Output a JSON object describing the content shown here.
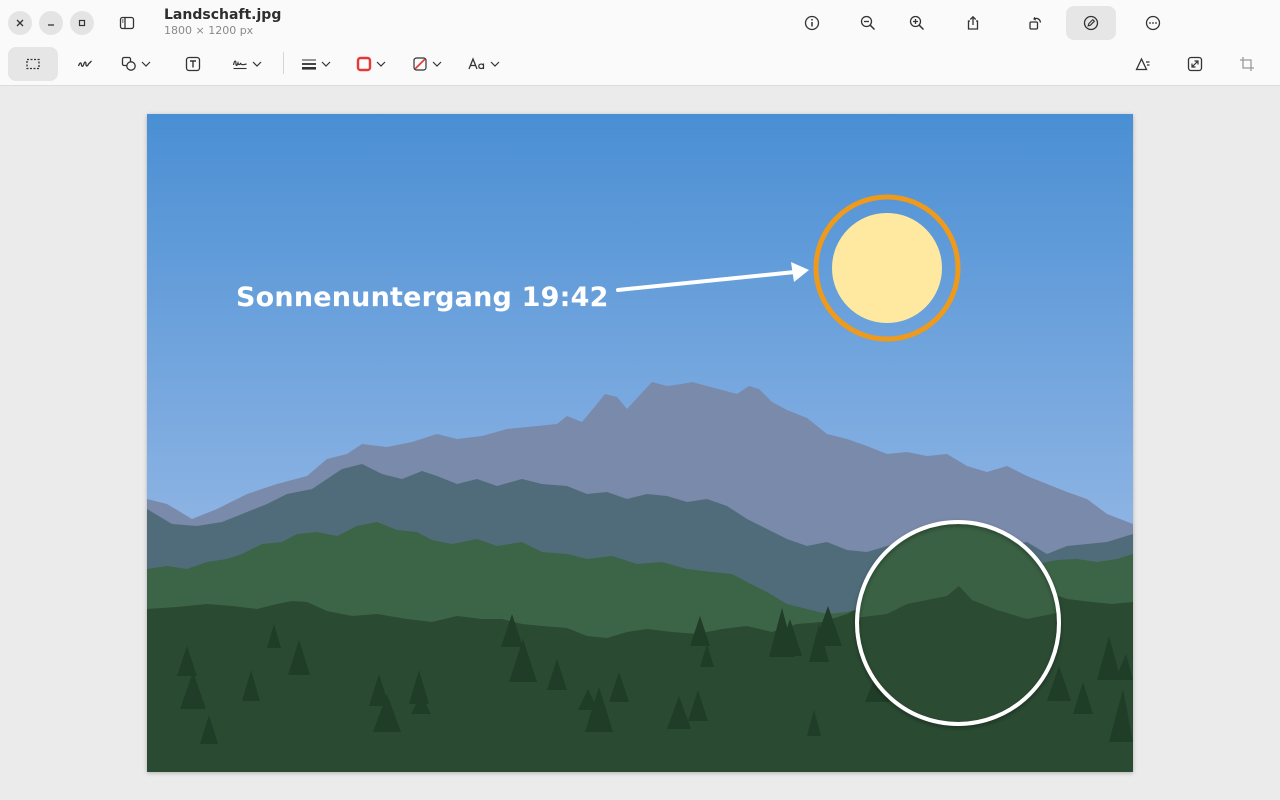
{
  "app": {
    "file_name": "Landschaft.jpg",
    "file_dimensions": "1800 × 1200 px"
  },
  "window_controls": [
    "close",
    "minimize",
    "maximize"
  ],
  "headerbar": {
    "buttons": [
      "info-icon",
      "zoom-out-icon",
      "zoom-in-icon",
      "share-icon",
      "rotate-icon",
      "markup-icon",
      "more-icon"
    ],
    "active": "markup-icon"
  },
  "toolbar": {
    "tools": [
      "rectangle-select-icon",
      "sketch-icon",
      "shapes-icon",
      "text-icon",
      "signature-icon",
      "line-weight-icon",
      "border-color-icon",
      "fill-color-icon",
      "font-icon",
      "adjust-color-icon",
      "resize-icon",
      "crop-icon"
    ],
    "active": "rectangle-select-icon",
    "border_color": "#e53935",
    "fill_color": "#e53935"
  },
  "image": {
    "annotation_text": "Sonnenuntergang 19:42",
    "sun_ring_color": "#ef9a1a",
    "magnifier_ring_color": "#ffffff",
    "sky_top": "#4a8fd4",
    "sky_bottom": "#9bbce6"
  }
}
